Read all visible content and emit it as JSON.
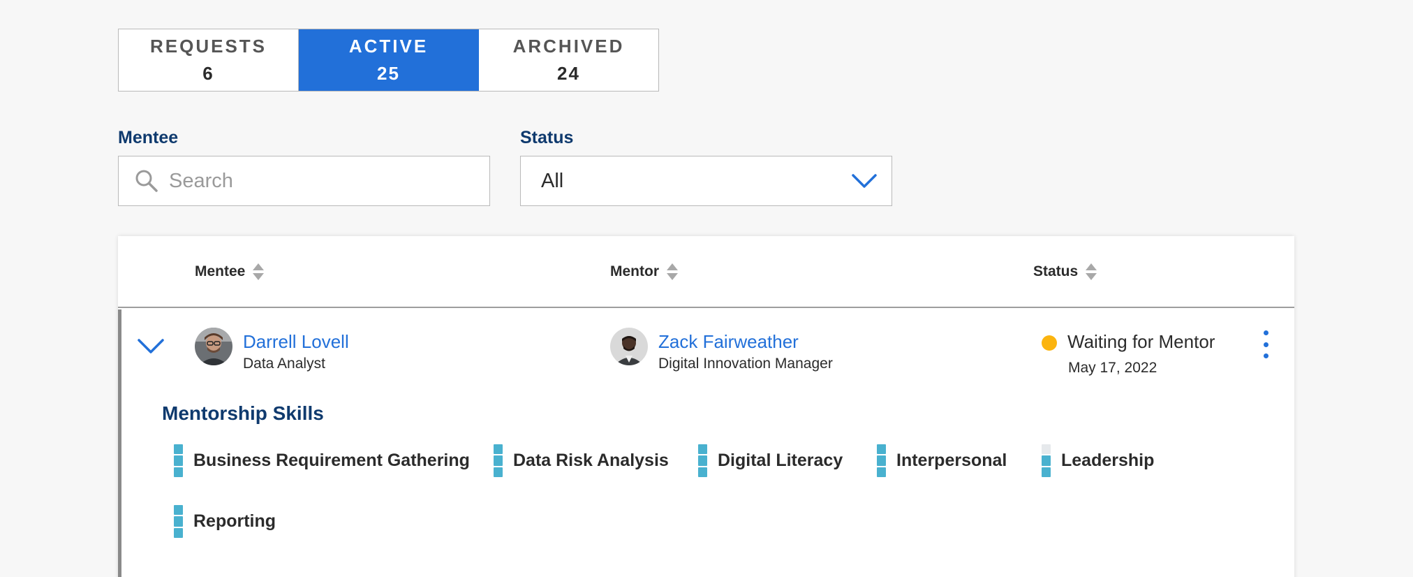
{
  "tabs": [
    {
      "label": "REQUESTS",
      "count": "6",
      "active": false
    },
    {
      "label": "ACTIVE",
      "count": "25",
      "active": true
    },
    {
      "label": "ARCHIVED",
      "count": "24",
      "active": false
    }
  ],
  "filters": {
    "mentee_label": "Mentee",
    "search_placeholder": "Search",
    "status_label": "Status",
    "status_value": "All"
  },
  "table": {
    "headers": {
      "mentee": "Mentee",
      "mentor": "Mentor",
      "status": "Status"
    },
    "rows": [
      {
        "mentee": {
          "name": "Darrell Lovell",
          "role": "Data Analyst"
        },
        "mentor": {
          "name": "Zack Fairweather",
          "role": "Digital Innovation Manager"
        },
        "status": {
          "text": "Waiting for Mentor",
          "date": "May 17, 2022",
          "color": "#fbb40f"
        },
        "skills_title": "Mentorship Skills",
        "skills": [
          {
            "name": "Business Requirement Gathering",
            "level": 3,
            "max": 3
          },
          {
            "name": "Data Risk Analysis",
            "level": 3,
            "max": 3
          },
          {
            "name": "Digital Literacy",
            "level": 3,
            "max": 3
          },
          {
            "name": "Interpersonal",
            "level": 3,
            "max": 3
          },
          {
            "name": "Leadership",
            "level": 2,
            "max": 3
          },
          {
            "name": "Reporting",
            "level": 3,
            "max": 3
          }
        ]
      }
    ]
  },
  "colors": {
    "accent": "#2270d9",
    "heading": "#0f3a6e",
    "skill": "#49b1cf",
    "status_waiting": "#fbb40f"
  },
  "icons": {
    "search": "search-icon",
    "dropdown": "chevron-down-icon",
    "sort": "sort-icon",
    "expand": "chevron-down-icon",
    "menu": "kebab-menu-icon"
  }
}
